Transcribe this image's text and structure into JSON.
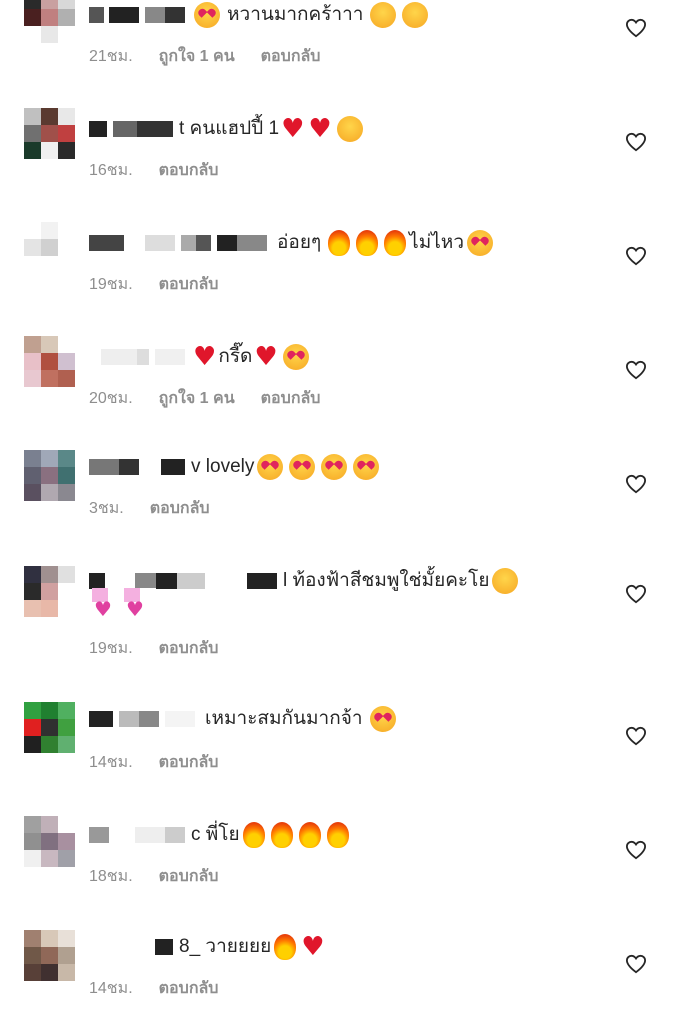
{
  "comments": [
    {
      "text": "หวานมากคร้าาา",
      "time": "21ชม.",
      "likes": "ถูกใจ 1 คน",
      "reply": "ตอบกลับ"
    },
    {
      "text": "t คนแฮปปี้ 1",
      "time": "16ชม.",
      "reply": "ตอบกลับ"
    },
    {
      "text": "อ่อยๆ",
      "text2": "ไม่ไหว",
      "time": "19ชม.",
      "reply": "ตอบกลับ"
    },
    {
      "text": "กรี๊ด",
      "time": "20ชม.",
      "likes": "ถูกใจ 1 คน",
      "reply": "ตอบกลับ"
    },
    {
      "text": "v lovely",
      "time": "3ชม.",
      "reply": "ตอบกลับ"
    },
    {
      "text": "l ท้องฟ้าสีชมพูใช่มั้ยคะโย",
      "time": "19ชม.",
      "reply": "ตอบกลับ"
    },
    {
      "text": "เหมาะสมกันมากจ้า",
      "time": "14ชม.",
      "reply": "ตอบกลับ"
    },
    {
      "text": "c พี่โย",
      "time": "18ชม.",
      "reply": "ตอบกลับ"
    },
    {
      "text": "8_ วายยยย",
      "time": "14ชม.",
      "reply": "ตอบกลับ"
    }
  ],
  "icons": {
    "like": "heart-outline-icon"
  },
  "colors": {
    "meta": "#8e8e8e",
    "text": "#262626",
    "red_heart": "#e0162b"
  }
}
